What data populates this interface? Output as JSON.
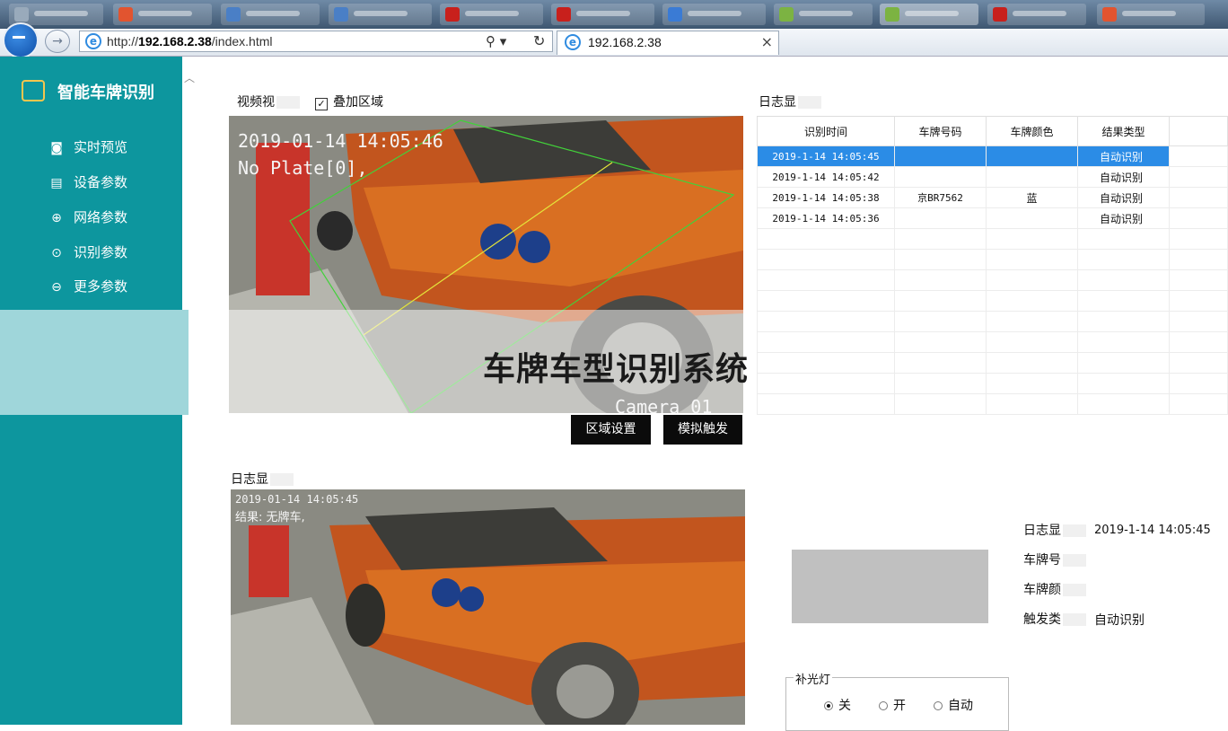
{
  "browser": {
    "url_prefix": "http://",
    "url_host": "192.168.2.38",
    "url_path": "/index.html",
    "search_glyph": "⚲ ▾",
    "refresh_glyph": "↻",
    "active_tab_title": "192.168.2.38",
    "close_glyph": "×"
  },
  "sidebar": {
    "logo_text": "智能车牌识别",
    "items": [
      {
        "label": "实时预览",
        "icon": "monitor-icon"
      },
      {
        "label": "设备参数",
        "icon": "device-icon"
      },
      {
        "label": "网络参数",
        "icon": "globe-icon"
      },
      {
        "label": "识别参数",
        "icon": "target-icon"
      },
      {
        "label": "更多参数",
        "icon": "more-icon"
      }
    ]
  },
  "video": {
    "label": "视频视",
    "overlay_checkbox_label": "叠加区域",
    "overlay_checked": true,
    "timestamp": "2019-01-14 14:05:46",
    "plate_text": "No Plate[0],",
    "camera_label": "Camera 01",
    "btn_region": "区域设置",
    "btn_trigger": "模拟触发"
  },
  "banner_title": "车牌车型识别系统",
  "log": {
    "label": "日志显",
    "columns": [
      "识别时间",
      "车牌号码",
      "车牌颜色",
      "结果类型",
      ""
    ],
    "rows": [
      {
        "time": "2019-1-14 14:05:45",
        "plate": "",
        "color": "",
        "type": "自动识别",
        "selected": true
      },
      {
        "time": "2019-1-14 14:05:42",
        "plate": "",
        "color": "",
        "type": "自动识别"
      },
      {
        "time": "2019-1-14 14:05:38",
        "plate": "京BR7562",
        "color": "蓝",
        "type": "自动识别"
      },
      {
        "time": "2019-1-14 14:05:36",
        "plate": "",
        "color": "",
        "type": "自动识别"
      }
    ]
  },
  "snapshot": {
    "label": "日志显",
    "timestamp": "2019-01-14 14:05:45",
    "result": "结果: 无牌车,"
  },
  "detail": {
    "time_label": "日志显",
    "time_value": "2019-1-14 14:05:45",
    "plate_label": "车牌号",
    "plate_value": "",
    "color_label": "车牌颜",
    "color_value": "",
    "trigger_label": "触发类",
    "trigger_value": "自动识别"
  },
  "fill_light": {
    "legend": "补光灯",
    "options": [
      "关",
      "开",
      "自动"
    ],
    "selected": "关"
  },
  "colors": {
    "sidebar": "#0d969e",
    "selection": "#2b8ce6",
    "button": "#0b0b0b"
  }
}
